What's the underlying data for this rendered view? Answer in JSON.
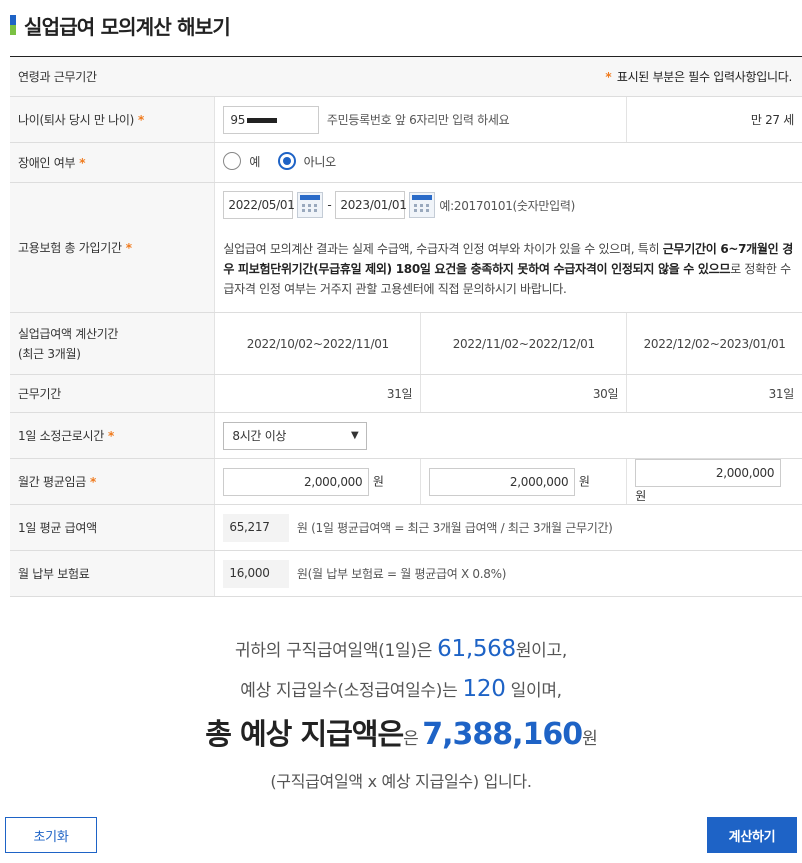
{
  "title": "실업급여 모의계산 해보기",
  "rows": {
    "section_label": "연령과 근무기간",
    "required_note": "표시된 부분은 필수 입력사항입니다.",
    "required_mark": "*",
    "age_label": "나이(퇴사 당시 만 나이)",
    "age_input_value": "95",
    "age_hint": "주민등록번호 앞 6자리만 입력 하세요",
    "age_result": "만 27 세",
    "disability_label": "장애인 여부",
    "disability_yes": "예",
    "disability_no": "아니오",
    "disability_selected": "아니오",
    "insurance_label": "고용보험 총 가입기간",
    "insurance_start": "2022/05/01",
    "insurance_dash": "-",
    "insurance_end": "2023/01/01",
    "insurance_hint": "예:20170101(숫자만입력)",
    "notice_1": "실업급여 모의계산 결과는 실제 수급액, 수급자격 인정 여부와 차이가 있을 수 있으며, 특히 ",
    "notice_bold": "근무기간이 6~7개월인 경우 피보험단위기간(무급휴일 제외) 180일 요건을 충족하지 못하여 수급자격이 인정되지 않을 수 있으므",
    "notice_2": "로 정확한 수급자격 인정 여부는 거주지 관할 고용센터에 직접 문의하시기 바랍니다.",
    "calc_period_label_1": "실업급여액 계산기간",
    "calc_period_label_2": "(최근 3개월)",
    "periods": [
      "2022/10/02~2022/11/01",
      "2022/11/02~2022/12/01",
      "2022/12/02~2023/01/01"
    ],
    "work_days_label": "근무기간",
    "work_days": [
      "31일",
      "30일",
      "31일"
    ],
    "hours_label": "1일 소정근로시간",
    "hours_value": "8시간 이상",
    "wage_label": "월간 평균임금",
    "wages": [
      "2,000,000",
      "2,000,000",
      "2,000,000"
    ],
    "won": "원",
    "daily_avg_label": "1일 평균 급여액",
    "daily_avg_value": "65,217",
    "daily_avg_note": "원 (1일 평균급여액 = 최근 3개월 급여액 / 최근 3개월 근무기간)",
    "premium_label": "월 납부 보험료",
    "premium_value": "16,000",
    "premium_note": "원(월 납부 보험료 = 월 평균급여 X 0.8%)"
  },
  "result": {
    "line1_pre": "귀하의 구직급여일액(1일)은 ",
    "daily_amount": "61,568",
    "line1_post": "원이고,",
    "line2_pre": "예상 지급일수(소정급여일수)는 ",
    "pay_days": "120",
    "line2_post": " 일이며,",
    "line3_pre": "총 예상 지급액은",
    "line3_small": "은 ",
    "total_amount": "7,388,160",
    "line3_post": "원",
    "line4": "(구직급여일액 x 예상 지급일수) 입니다."
  },
  "buttons": {
    "reset": "초기화",
    "calculate": "계산하기"
  },
  "colors": {
    "accent": "#1e63c6",
    "required": "#f07b1e"
  }
}
